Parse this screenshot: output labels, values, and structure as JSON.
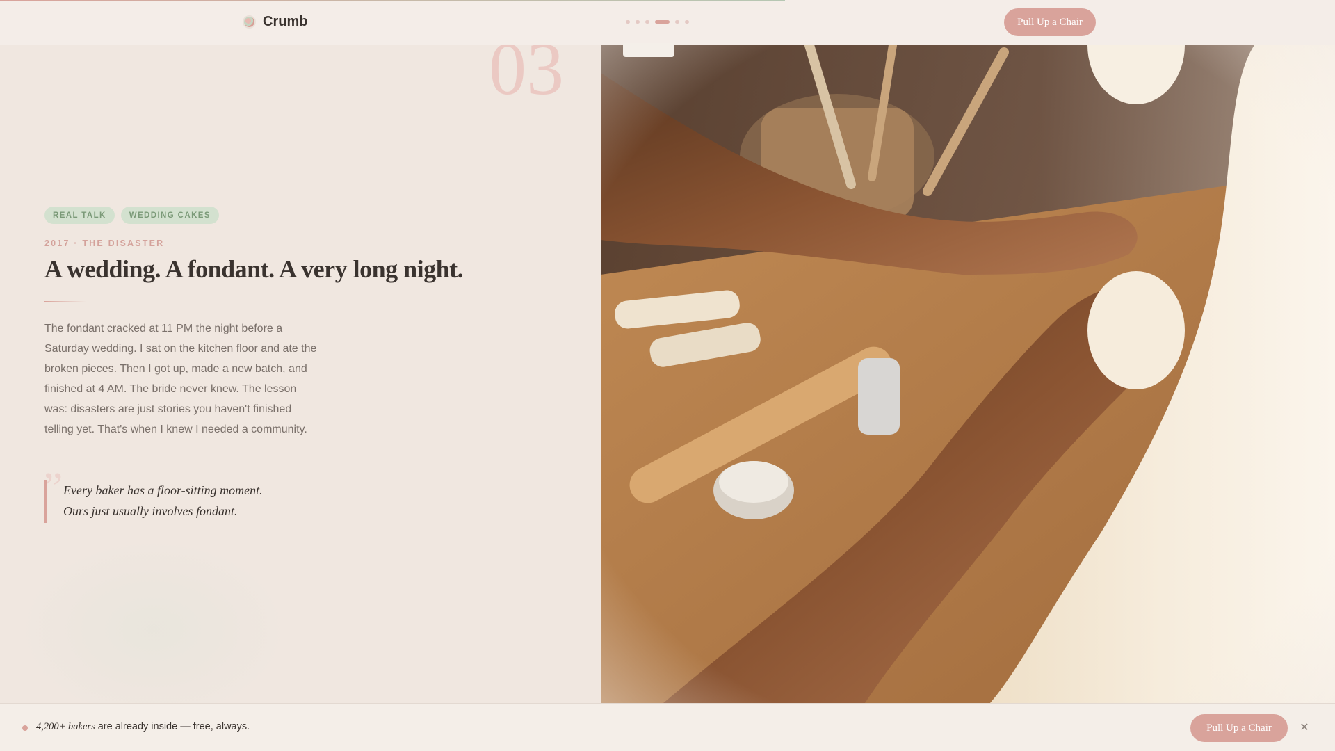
{
  "header": {
    "brand": "Crumb",
    "cta_label": "Pull Up a Chair",
    "progress": {
      "total": 6,
      "active": 4
    }
  },
  "section": {
    "number": "03",
    "tags": [
      "REAL TALK",
      "WEDDING CAKES"
    ],
    "eyebrow": "2017 · THE DISASTER",
    "title": "A wedding. A fondant. A very long night.",
    "body": "The fondant cracked at 11 PM the night before a Saturday wedding. I sat on the kitchen floor and ate the broken pieces. Then I got up, made a new batch, and finished at 4 AM. The bride never knew. The lesson was: disasters are just stories you haven't finished telling yet. That's when I knew I needed a community.",
    "quote_mark": "”",
    "quote_lines": [
      "Every baker has a floor-sitting moment.",
      "Ours just usually involves fondant."
    ]
  },
  "bottom_bar": {
    "count_text": "4,200+ bakers",
    "suffix_text": " are already inside — free, always.",
    "cta_label": "Pull Up a Chair",
    "close_symbol": "✕"
  },
  "colors": {
    "accent": "#d9a39b",
    "sage": "#d3e1cf",
    "background": "#f0e7e0"
  }
}
